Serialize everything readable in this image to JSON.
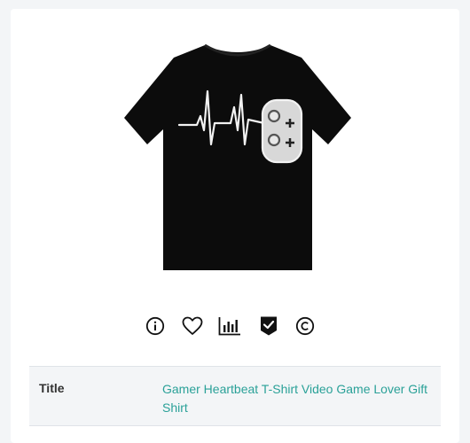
{
  "product": {
    "image_alt": "Gamer Heartbeat T-Shirt Video Game Lover Gift Shirt",
    "shirt_color": "#0c0c0c",
    "print_color": "#f2f2f2"
  },
  "actions": [
    {
      "name": "info-icon",
      "label": "Info"
    },
    {
      "name": "heart-icon",
      "label": "Favorite"
    },
    {
      "name": "bar-chart-icon",
      "label": "Statistics"
    },
    {
      "name": "shield-check-icon",
      "label": "Verified"
    },
    {
      "name": "copyright-icon",
      "label": "Copyright"
    }
  ],
  "details": {
    "rows": [
      {
        "label": "Title",
        "value": "Gamer Heartbeat T-Shirt Video Game Lover Gift Shirt"
      }
    ]
  },
  "colors": {
    "accent": "#2aa198",
    "row_background": "#f3f5f7",
    "page_background": "#f3f5f7"
  }
}
